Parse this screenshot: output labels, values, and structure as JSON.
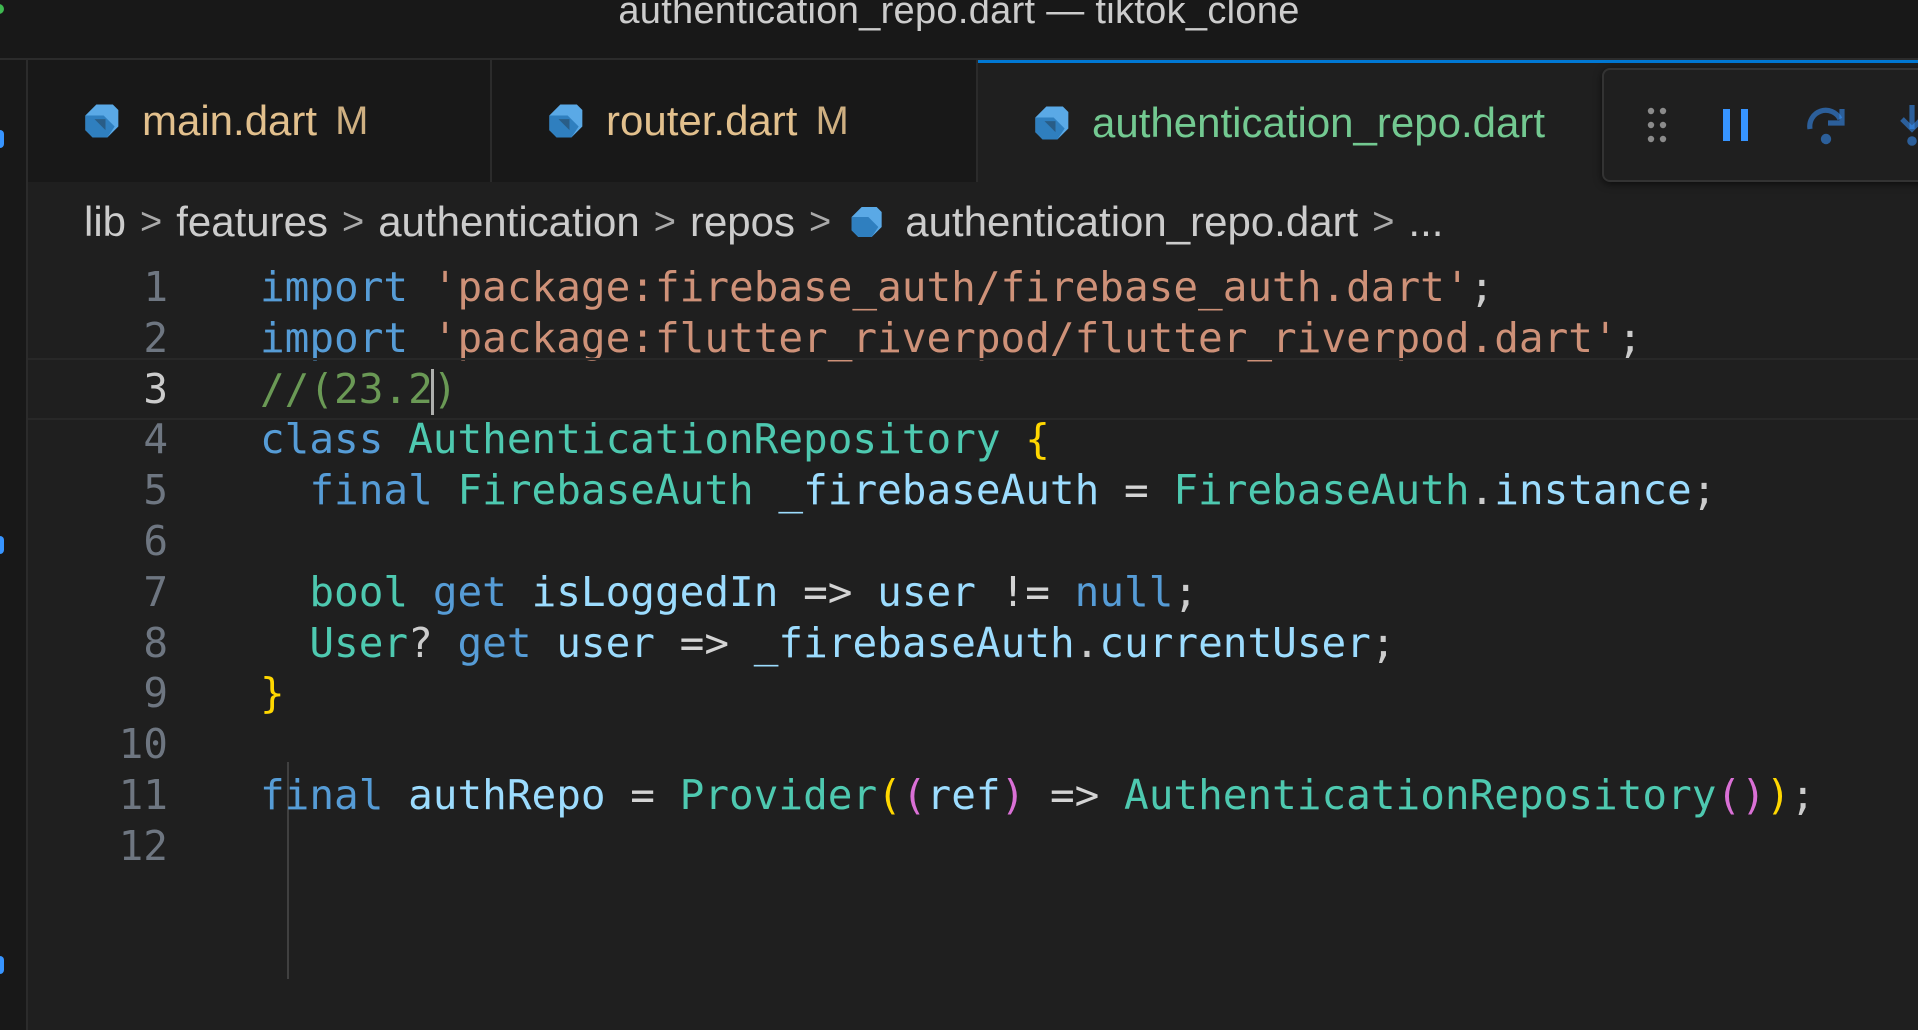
{
  "window": {
    "title": "authentication_repo.dart — tiktok_clone"
  },
  "tabs": [
    {
      "label": "main.dart",
      "status": "M",
      "icon": "dart-icon"
    },
    {
      "label": "router.dart",
      "status": "M",
      "icon": "dart-icon"
    },
    {
      "label": "authentication_repo.dart",
      "status": "",
      "icon": "dart-icon"
    }
  ],
  "debug_toolbar": {
    "buttons": [
      "drag-handle-icon",
      "pause-icon",
      "step-over-icon",
      "step-into-icon"
    ],
    "accent": "#3794ff"
  },
  "breadcrumb": {
    "items": [
      "lib",
      "features",
      "authentication",
      "repos",
      "authentication_repo.dart",
      "..."
    ]
  },
  "editor": {
    "current_line": 3,
    "line_numbers": [
      "1",
      "2",
      "3",
      "4",
      "5",
      "6",
      "7",
      "8",
      "9",
      "10",
      "11",
      "12"
    ],
    "lines": [
      {
        "tokens": [
          {
            "t": "import",
            "c": "kw"
          },
          {
            "t": " "
          },
          {
            "t": "'package:firebase_auth/firebase_auth.dart'",
            "c": "str"
          },
          {
            "t": ";"
          }
        ]
      },
      {
        "tokens": [
          {
            "t": "import",
            "c": "kw"
          },
          {
            "t": " "
          },
          {
            "t": "'package:flutter_riverpod/flutter_riverpod.dart'",
            "c": "str"
          },
          {
            "t": ";"
          }
        ]
      },
      {
        "tokens": [
          {
            "t": "//(23.2",
            "c": "cm"
          },
          {
            "t": "|CURSOR|"
          },
          {
            "t": ")",
            "c": "cm"
          }
        ]
      },
      {
        "tokens": [
          {
            "t": "class",
            "c": "kw"
          },
          {
            "t": " "
          },
          {
            "t": "AuthenticationRepository",
            "c": "ty"
          },
          {
            "t": " "
          },
          {
            "t": "{",
            "c": "br1"
          }
        ]
      },
      {
        "tokens": [
          {
            "t": "  "
          },
          {
            "t": "final",
            "c": "kw"
          },
          {
            "t": " "
          },
          {
            "t": "FirebaseAuth",
            "c": "ty"
          },
          {
            "t": " "
          },
          {
            "t": "_firebaseAuth",
            "c": "vr"
          },
          {
            "t": " = ",
            "c": "op"
          },
          {
            "t": "FirebaseAuth",
            "c": "ty"
          },
          {
            "t": "."
          },
          {
            "t": "instance",
            "c": "vr"
          },
          {
            "t": ";"
          }
        ]
      },
      {
        "tokens": []
      },
      {
        "tokens": [
          {
            "t": "  "
          },
          {
            "t": "bool",
            "c": "ty"
          },
          {
            "t": " "
          },
          {
            "t": "get",
            "c": "kw"
          },
          {
            "t": " "
          },
          {
            "t": "isLoggedIn",
            "c": "vr"
          },
          {
            "t": " => ",
            "c": "op"
          },
          {
            "t": "user",
            "c": "vr"
          },
          {
            "t": " != ",
            "c": "op"
          },
          {
            "t": "null",
            "c": "kw"
          },
          {
            "t": ";"
          }
        ]
      },
      {
        "tokens": [
          {
            "t": "  "
          },
          {
            "t": "User",
            "c": "ty"
          },
          {
            "t": "? "
          },
          {
            "t": "get",
            "c": "kw"
          },
          {
            "t": " "
          },
          {
            "t": "user",
            "c": "vr"
          },
          {
            "t": " => ",
            "c": "op"
          },
          {
            "t": "_firebaseAuth",
            "c": "vr"
          },
          {
            "t": "."
          },
          {
            "t": "currentUser",
            "c": "vr"
          },
          {
            "t": ";"
          }
        ]
      },
      {
        "tokens": [
          {
            "t": "}",
            "c": "br1"
          }
        ]
      },
      {
        "tokens": []
      },
      {
        "tokens": [
          {
            "t": "final",
            "c": "kw"
          },
          {
            "t": " "
          },
          {
            "t": "authRepo",
            "c": "vr"
          },
          {
            "t": " = ",
            "c": "op"
          },
          {
            "t": "Provider",
            "c": "ty"
          },
          {
            "t": "(",
            "c": "br1"
          },
          {
            "t": "(",
            "c": "br2"
          },
          {
            "t": "ref",
            "c": "vr"
          },
          {
            "t": ")",
            "c": "br2"
          },
          {
            "t": " => ",
            "c": "op"
          },
          {
            "t": "AuthenticationRepository",
            "c": "ty"
          },
          {
            "t": "(",
            "c": "br2"
          },
          {
            "t": ")",
            "c": "br2"
          },
          {
            "t": ")",
            "c": "br1"
          },
          {
            "t": ";"
          }
        ]
      },
      {
        "tokens": []
      }
    ]
  },
  "colors": {
    "editor_bg": "#1f1f1f",
    "modified_tab": "#e2c08d",
    "active_tab_text": "#73c991",
    "active_tab_border": "#0078d4"
  }
}
